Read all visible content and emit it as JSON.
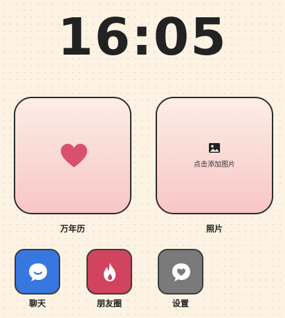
{
  "clock": {
    "time": "16:05"
  },
  "widgets": {
    "calendar": {
      "label": "万年历",
      "icon": "heart-icon"
    },
    "photo": {
      "label": "照片",
      "hint": "点击添加图片",
      "icon": "image-icon"
    }
  },
  "apps": [
    {
      "label": "聊天",
      "icon": "chat-bubble-icon",
      "color": "#3677e0"
    },
    {
      "label": "朋友圈",
      "icon": "flame-icon",
      "color": "#d0445f"
    },
    {
      "label": "设置",
      "icon": "heart-bubble-icon",
      "color": "#7a7a7a"
    }
  ]
}
